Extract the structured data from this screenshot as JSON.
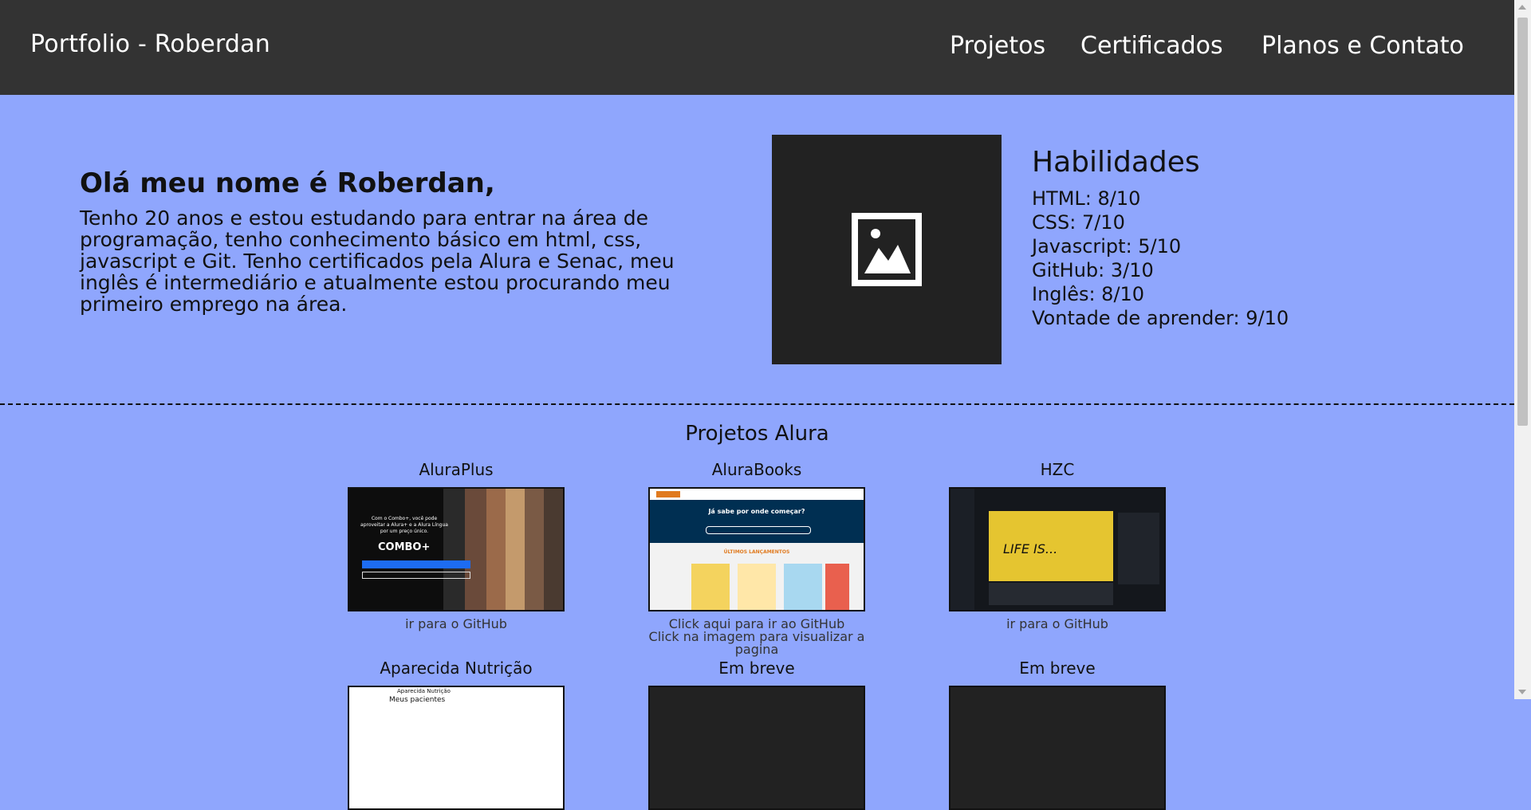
{
  "header": {
    "brand": "Portfolio - Roberdan",
    "nav": [
      "Projetos",
      "Certificados",
      "Planos e Contato"
    ]
  },
  "intro": {
    "heading": "Olá meu nome é Roberdan,",
    "paragraph": "Tenho 20 anos e estou estudando para entrar na área de programação, tenho conhecimento básico em html, css, javascript e Git. Tenho certificados pela Alura e Senac, meu inglês é intermediário e atualmente estou procurando meu primeiro emprego na área."
  },
  "skills": {
    "title": "Habilidades",
    "items": [
      "HTML: 8/10",
      "CSS: 7/10",
      "Javascript: 5/10",
      "GitHub: 3/10",
      "Inglês: 8/10",
      "Vontade de aprender: 9/10"
    ]
  },
  "projects": {
    "title": "Projetos Alura",
    "cards": [
      {
        "title": "AluraPlus",
        "link": "ir para o GitHub",
        "hint": ""
      },
      {
        "title": "AluraBooks",
        "link": "Click aqui para ir ao GitHub",
        "hint": "Click na imagem para visualizar a pagina"
      },
      {
        "title": "HZC",
        "link": "ir para o GitHub",
        "hint": ""
      },
      {
        "title": "Aparecida Nutrição",
        "link": "",
        "hint": ""
      },
      {
        "title": "Em breve",
        "link": "",
        "hint": ""
      },
      {
        "title": "Em breve",
        "link": "",
        "hint": ""
      }
    ]
  },
  "thumbs": {
    "aluraplus_text": "Com o Combo+, você pode aproveitar a Alura+ e a Alura Língua por um preço único.",
    "aluraplus_combo": "COMBO+",
    "alurabooks_heading": "Já sabe por onde começar?",
    "alurabooks_section": "ÚLTIMOS LANÇAMENTOS",
    "hzc_art": "LIFE IS...",
    "aparecida_header": "Aparecida Nutrição",
    "aparecida_sub": "Meus pacientes"
  },
  "colors": {
    "background": "#8fa6fd",
    "topbar": "#333333",
    "photo_placeholder": "#222222"
  }
}
